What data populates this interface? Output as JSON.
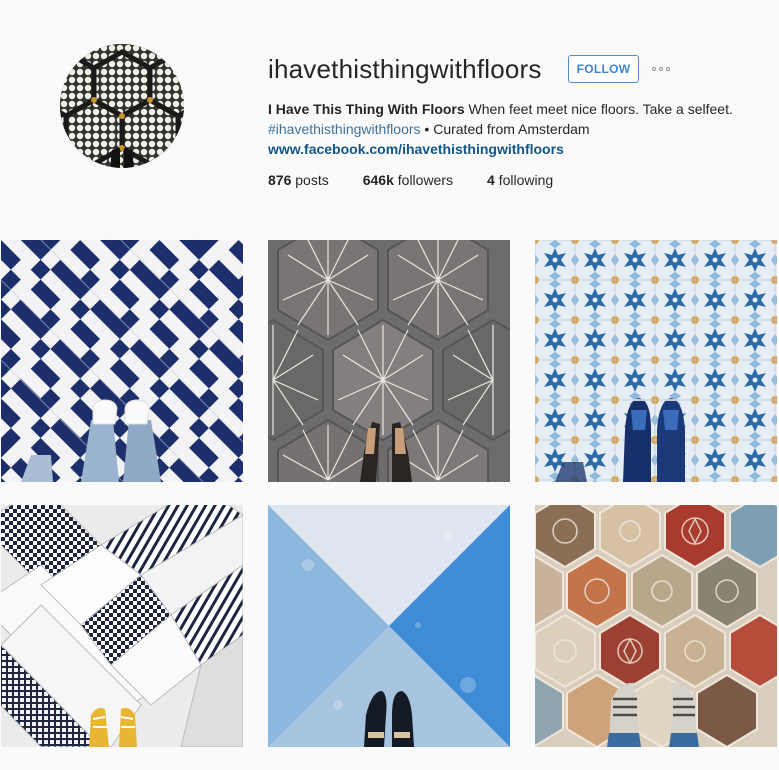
{
  "profile": {
    "username": "ihavethisthingwithfloors",
    "follow_label": "FOLLOW",
    "full_name": "I Have This Thing With Floors",
    "bio_text": " When feet meet nice floors. Take a selfeet.",
    "hashtag": "#ihavethisthingwithfloors",
    "bio_suffix": " • Curated from Amsterdam",
    "website": "www.facebook.com/ihavethisthingwithfloors"
  },
  "stats": {
    "posts_count": "876",
    "posts_label": " posts",
    "followers_count": "646k",
    "followers_label": " followers",
    "following_count": "4",
    "following_label": " following"
  },
  "colors": {
    "accent": "#3f84c9",
    "background": "#fafafa"
  },
  "icons": {
    "more": "more-options-icon"
  }
}
